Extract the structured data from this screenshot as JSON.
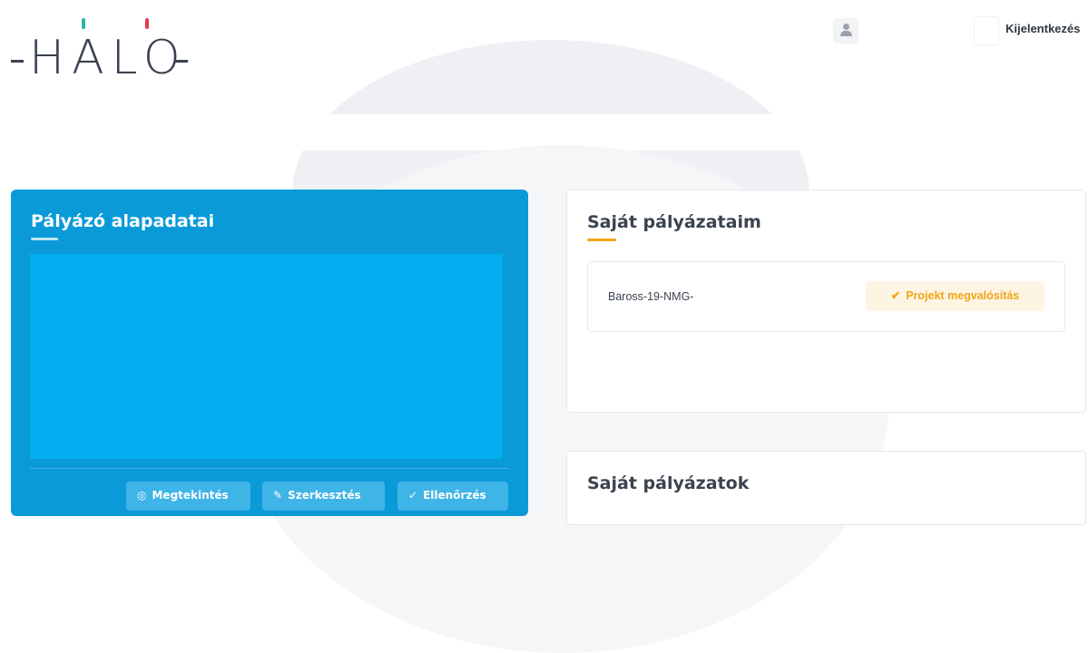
{
  "header": {
    "logo_text": "HALO",
    "logout_label": "Kijelentkezés",
    "colors": {
      "logo_tick_teal": "#2bb3a3",
      "logo_tick_red": "#e63b4b"
    }
  },
  "applicant_card": {
    "title": "Pályázó alapadatai",
    "buttons": [
      {
        "icon": "eye-icon",
        "glyph": "◎",
        "label": "Megtekintés"
      },
      {
        "icon": "pencil-icon",
        "glyph": "✎",
        "label": "Szerkesztés"
      },
      {
        "icon": "check-icon",
        "glyph": "✓",
        "label": "Ellenőrzés"
      }
    ],
    "colors": {
      "card": "#0a9ad8",
      "panel": "#03aef0"
    }
  },
  "own_applications_card": {
    "title": "Saját pályázataim",
    "items": [
      {
        "id": "Baross-19-NMG-",
        "status": "Projekt megvalósítás",
        "status_icon": "check-icon"
      }
    ],
    "colors": {
      "accent": "#f2a516",
      "badge_bg": "#fdf4e4"
    }
  },
  "own_applications_card2": {
    "title": "Saját pályázatok"
  }
}
